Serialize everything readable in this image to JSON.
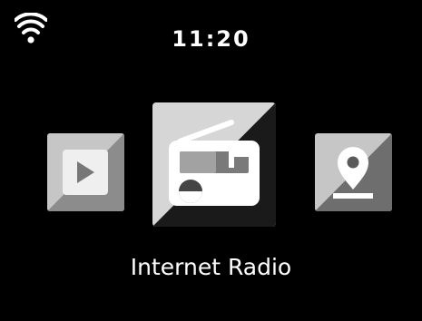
{
  "status_bar": {
    "clock": "11:20",
    "wifi_icon": "wifi-icon"
  },
  "menu": {
    "selected_label": "Internet Radio",
    "items": [
      {
        "id": "media-player",
        "icon": "play-icon",
        "selected": false
      },
      {
        "id": "internet-radio",
        "icon": "radio-icon",
        "selected": true
      },
      {
        "id": "location",
        "icon": "location-pin-icon",
        "selected": false
      }
    ]
  },
  "colors": {
    "background": "#000000",
    "tile_light": "#c8c8c8",
    "tile_dark": "#8a8a8a",
    "center_tile_light": "#d7d7d7",
    "center_tile_dark": "#1b1b1b",
    "icon": "#ffffff"
  }
}
